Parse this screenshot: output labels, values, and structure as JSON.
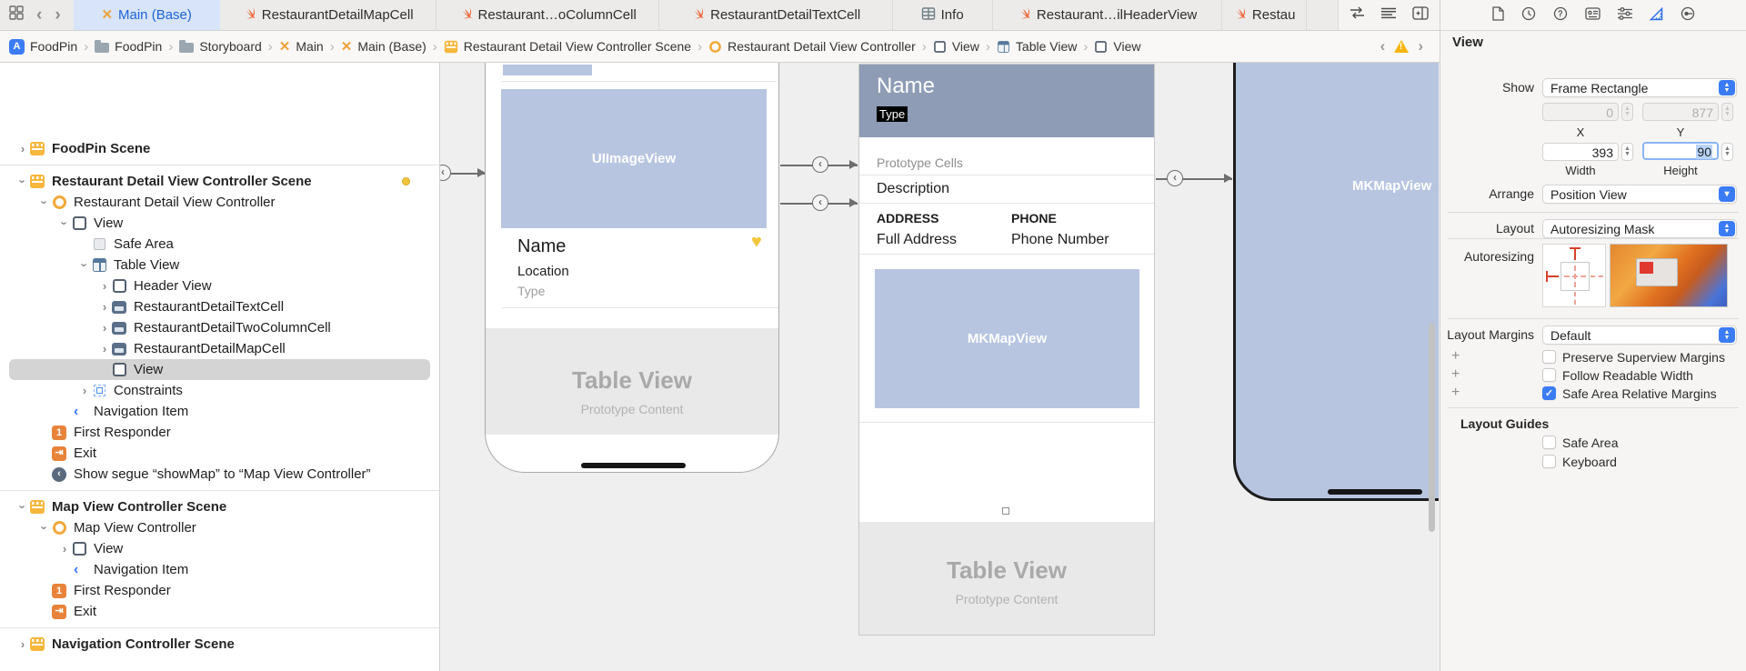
{
  "tabbar": {
    "nav_icons": [
      "tab-overview-icon",
      "back-chevron",
      "forward-chevron"
    ],
    "tabs": [
      {
        "label": "Main (Base)",
        "icon": "storyboard",
        "active": true
      },
      {
        "label": "RestaurantDetailMapCell",
        "icon": "swift",
        "active": false
      },
      {
        "label": "Restaurant…oColumnCell",
        "icon": "swift",
        "active": false
      },
      {
        "label": "RestaurantDetailTextCell",
        "icon": "swift",
        "active": false
      },
      {
        "label": "Info",
        "icon": "table",
        "active": false
      },
      {
        "label": "Restaurant…ilHeaderView",
        "icon": "swift",
        "active": false
      },
      {
        "label": "Restau",
        "icon": "swift",
        "active": false
      }
    ],
    "editor_controls": [
      "adjust-editor-icon",
      "editor-list-icon",
      "add-editor-icon"
    ]
  },
  "jumpbar": {
    "items": [
      {
        "label": "FoodPin",
        "icon": "app"
      },
      {
        "label": "FoodPin",
        "icon": "folder"
      },
      {
        "label": "Storyboard",
        "icon": "folder"
      },
      {
        "label": "Main",
        "icon": "storyboard"
      },
      {
        "label": "Main (Base)",
        "icon": "storyboard"
      },
      {
        "label": "Restaurant Detail View Controller Scene",
        "icon": "scene"
      },
      {
        "label": "Restaurant Detail View Controller",
        "icon": "vc"
      },
      {
        "label": "View",
        "icon": "view"
      },
      {
        "label": "Table View",
        "icon": "table"
      },
      {
        "label": "View",
        "icon": "view"
      }
    ],
    "issue_nav": {
      "prev": "‹",
      "warning": "warning-triangle",
      "next": "›"
    }
  },
  "outline": {
    "sections": [
      {
        "rows": [
          {
            "label": "FoodPin Scene",
            "icon": "scene",
            "level": 0,
            "disc": "collapsed",
            "scene": true
          }
        ]
      },
      {
        "rows": [
          {
            "label": "Restaurant Detail View Controller Scene",
            "icon": "scene",
            "level": 0,
            "disc": "expanded",
            "scene": true,
            "warn_dot": true
          },
          {
            "label": "Restaurant Detail View Controller",
            "icon": "vc",
            "level": 1,
            "disc": "expanded"
          },
          {
            "label": "View",
            "icon": "view",
            "level": 2,
            "disc": "expanded"
          },
          {
            "label": "Safe Area",
            "icon": "safearea",
            "level": 3,
            "disc": "none"
          },
          {
            "label": "Table View",
            "icon": "table",
            "level": 3,
            "disc": "expanded"
          },
          {
            "label": "Header View",
            "icon": "view",
            "level": 4,
            "disc": "collapsed"
          },
          {
            "label": "RestaurantDetailTextCell",
            "icon": "cell",
            "level": 4,
            "disc": "collapsed"
          },
          {
            "label": "RestaurantDetailTwoColumnCell",
            "icon": "cell",
            "level": 4,
            "disc": "collapsed"
          },
          {
            "label": "RestaurantDetailMapCell",
            "icon": "cell",
            "level": 4,
            "disc": "collapsed"
          },
          {
            "label": "View",
            "icon": "view",
            "level": 4,
            "disc": "none",
            "selected": true
          },
          {
            "label": "Constraints",
            "icon": "constraints",
            "level": 3,
            "disc": "collapsed"
          },
          {
            "label": "Navigation Item",
            "icon": "navitem",
            "level": 2,
            "disc": "none"
          },
          {
            "label": "First Responder",
            "icon": "first",
            "level": 1,
            "disc": "none"
          },
          {
            "label": "Exit",
            "icon": "exit",
            "level": 1,
            "disc": "none"
          },
          {
            "label": "Show segue “showMap” to “Map View Controller”",
            "icon": "segue",
            "level": 1,
            "disc": "none"
          }
        ]
      },
      {
        "rows": [
          {
            "label": "Map View Controller Scene",
            "icon": "scene",
            "level": 0,
            "disc": "expanded",
            "scene": true
          },
          {
            "label": "Map View Controller",
            "icon": "vc",
            "level": 1,
            "disc": "expanded"
          },
          {
            "label": "View",
            "icon": "view",
            "level": 2,
            "disc": "collapsed"
          },
          {
            "label": "Navigation Item",
            "icon": "navitem",
            "level": 2,
            "disc": "none"
          },
          {
            "label": "First Responder",
            "icon": "first",
            "level": 1,
            "disc": "none"
          },
          {
            "label": "Exit",
            "icon": "exit",
            "level": 1,
            "disc": "none"
          }
        ]
      },
      {
        "rows": [
          {
            "label": "Navigation Controller Scene",
            "icon": "scene",
            "level": 0,
            "disc": "collapsed",
            "scene": true
          }
        ]
      }
    ]
  },
  "canvas": {
    "detail_cell_device": {
      "image_label": "UIImageView",
      "name": "Name",
      "location": "Location",
      "type": "Type",
      "heart_icon": "heart-icon",
      "table_view": "Table View",
      "prototype": "Prototype Content"
    },
    "detail_table_controller": {
      "header_name": "Name",
      "header_type": "Type",
      "prototype_cells": "Prototype Cells",
      "description": "Description",
      "address_header": "ADDRESS",
      "phone_header": "PHONE",
      "address_value": "Full Address",
      "phone_value": "Phone Number",
      "map_label": "MKMapView",
      "table_view": "Table View",
      "prototype": "Prototype Content"
    },
    "map_device": {
      "map_label": "MKMapView"
    }
  },
  "inspector": {
    "icons": [
      "file-inspector-icon",
      "history-inspector-icon",
      "help-inspector-icon",
      "identity-inspector-icon",
      "attributes-inspector-icon",
      "size-inspector-icon",
      "connections-inspector-icon"
    ],
    "selected_icon": "size-inspector-icon",
    "title": "View",
    "show": {
      "label": "Show",
      "value": "Frame Rectangle"
    },
    "frame": {
      "x": "0",
      "y": "877",
      "x_label": "X",
      "y_label": "Y",
      "width": "393",
      "height": "90",
      "width_label": "Width",
      "height_label": "Height"
    },
    "arrange": {
      "label": "Arrange",
      "value": "Position View"
    },
    "layout": {
      "label": "Layout",
      "value": "Autoresizing Mask"
    },
    "autoresizing_label": "Autoresizing",
    "layout_margins": {
      "label": "Layout Margins",
      "value": "Default"
    },
    "margin_options": [
      {
        "label": "Preserve Superview Margins",
        "checked": false
      },
      {
        "label": "Follow Readable Width",
        "checked": false
      },
      {
        "label": "Safe Area Relative Margins",
        "checked": true
      }
    ],
    "layout_guides": {
      "title": "Layout Guides",
      "options": [
        {
          "label": "Safe Area",
          "checked": false
        },
        {
          "label": "Keyboard",
          "checked": false
        }
      ]
    },
    "accent_color": "#3b7cf6",
    "warning_color": "#f7b50c"
  }
}
